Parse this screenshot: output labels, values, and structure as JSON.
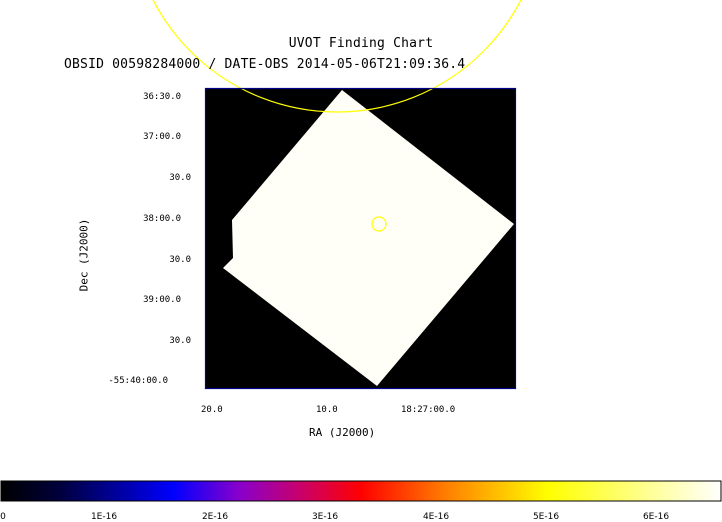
{
  "title": "UVOT Finding Chart",
  "subtitle": "OBSID 00598284000 / DATE-OBS 2014-05-06T21:09:36.4",
  "axes": {
    "xlabel": "RA (J2000)",
    "ylabel": "Dec (J2000)",
    "x_ticks": [
      "20.0",
      "10.0",
      "18:27:00.0"
    ],
    "y_ticks": [
      "36:30.0",
      "37:00.0",
      "30.0",
      "38:00.0",
      "30.0",
      "39:00.0",
      "30.0",
      "-55:40:00.0"
    ]
  },
  "colorbar": {
    "ticks": [
      "0",
      "1E-16",
      "2E-16",
      "3E-16",
      "4E-16",
      "5E-16",
      "6E-16"
    ],
    "colors": [
      "#000000",
      "#0000ff",
      "#ff0000",
      "#ffff00",
      "#ffffff"
    ]
  },
  "colors": {
    "frame": "#00008b",
    "image_background": "#000000",
    "exposure_region": "#fffff8",
    "circles": "#ffff00"
  }
}
